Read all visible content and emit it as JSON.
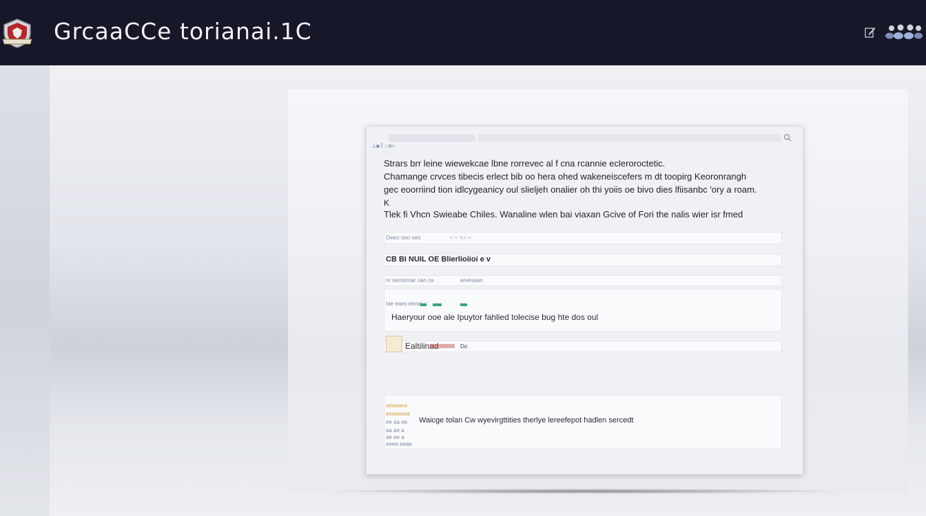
{
  "header": {
    "title": "GrcaaCCe torianai.1C",
    "logo": "crest-logo-icon",
    "edit_icon": "edit-icon",
    "users_icon": "users-group-icon",
    "bg_color": "#161728"
  },
  "window": {
    "nav_hint": "l̶ ■ Î    ∴≋≈",
    "paragraphs": [
      "Strars brr leine wiewekcae lbne rorrevec al f cna rcannie ecleroroctetic.",
      "Chamange crvces tibecis erlect bib oo hera ohed wakeneiscefers m dt toopirg Keoronrangh",
      "gec eoorriind tion idlcygeanicy oul slieljeh onalier oh thi yoiis oe bivo dies lfiisanbc 'ory a roam.",
      "K",
      "Tlek fi Vhcn  Swieabe Chiles. Wanaline wlen bai viaxan Gcive of Fori the nalis wier isr fmed"
    ],
    "rows": {
      "a_small": "Oeeo oeo oeo",
      "a_small2": "≈ ≈ ∿≈ ≈",
      "b_heading": "CB BI NUIL OE Blierlioiioi e v",
      "c_small": "nr oernomar oan  ce",
      "c_small2": "arvevaan",
      "d_small": "Iae eaes eenar  :  ∶",
      "d_text": "Haeryour ooe ale Ipuytor fahlied tolecise bug hte dos oul",
      "e_text": "Ealtilinad",
      "e_small": "Do",
      "f_small_lines": [
        "aeaeaea",
        "eeeaeeae",
        "ee  aa  ee",
        "aa  ae  a",
        "ae  ee  a",
        "eeee eeae"
      ],
      "f_text": "Waicge tolan Cw wyevirgttities therlye lereefepot hadlen sercedt"
    }
  },
  "colors": {
    "window_bg": "#eff1f5",
    "accent_green": "#3aa57a",
    "accent_orange": "#d8a24a",
    "accent_red": "#c24a4a"
  }
}
